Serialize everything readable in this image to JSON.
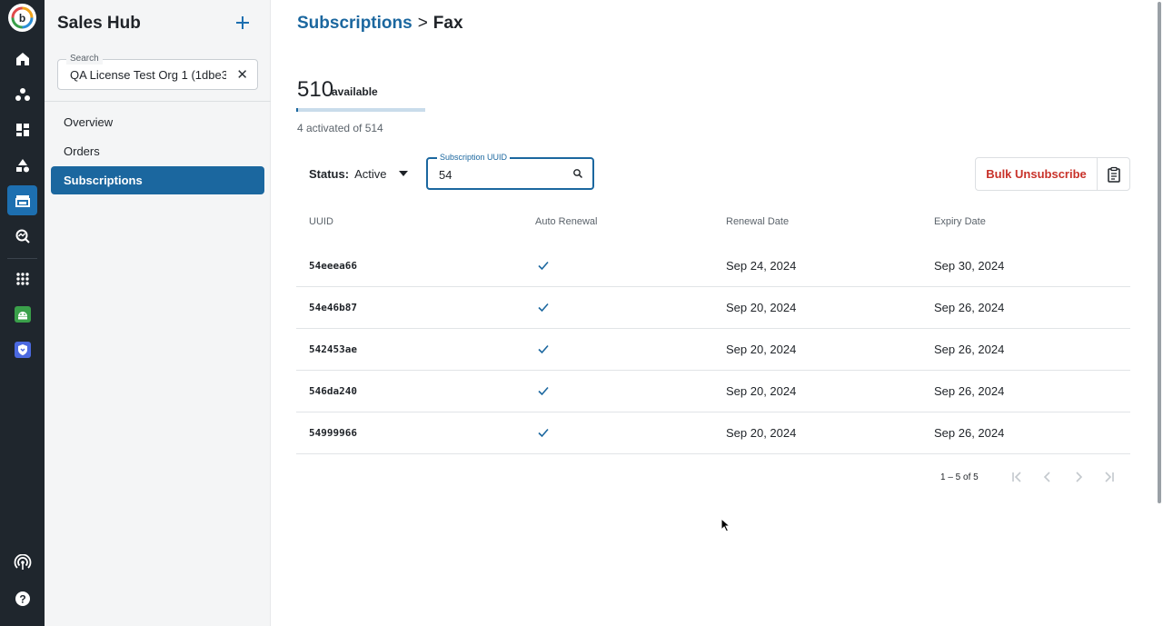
{
  "rail": {
    "icons": [
      "home-icon",
      "cluster-icon",
      "dashboard-icon",
      "shapes-icon",
      "store-icon",
      "analytics-search-icon",
      "apps-grid-icon",
      "android-icon",
      "shield-icon",
      "broadcast-icon",
      "help-icon"
    ],
    "active": "store-icon",
    "colors": {
      "bg": "#1f262d",
      "active": "#1d6fb0",
      "android": "#3aa04a",
      "shield": "#4b69e0"
    }
  },
  "sidebar": {
    "title": "Sales Hub",
    "search": {
      "label": "Search",
      "value": "QA License Test Org 1 (1dbe3"
    },
    "items": [
      {
        "label": "Overview",
        "active": false
      },
      {
        "label": "Orders",
        "active": false
      },
      {
        "label": "Subscriptions",
        "active": true
      }
    ]
  },
  "breadcrumb": {
    "parent": "Subscriptions",
    "separator": ">",
    "current": "Fax"
  },
  "summary": {
    "available_count": "510",
    "available_label": "available",
    "activated_text": "4 activated of 514",
    "usage_fraction": 0.0078
  },
  "filters": {
    "status_label": "Status:",
    "status_value": "Active",
    "uuid_label": "Subscription UUID",
    "uuid_value": "54"
  },
  "actions": {
    "bulk_unsubscribe": "Bulk Unsubscribe"
  },
  "table": {
    "columns": [
      "UUID",
      "Auto Renewal",
      "Renewal Date",
      "Expiry Date"
    ],
    "rows": [
      {
        "uuid": "54eeea66",
        "auto_renewal": true,
        "renewal": "Sep 24, 2024",
        "expiry": "Sep 30, 2024"
      },
      {
        "uuid": "54e46b87",
        "auto_renewal": true,
        "renewal": "Sep 20, 2024",
        "expiry": "Sep 26, 2024"
      },
      {
        "uuid": "542453ae",
        "auto_renewal": true,
        "renewal": "Sep 20, 2024",
        "expiry": "Sep 26, 2024"
      },
      {
        "uuid": "546da240",
        "auto_renewal": true,
        "renewal": "Sep 20, 2024",
        "expiry": "Sep 26, 2024"
      },
      {
        "uuid": "54999966",
        "auto_renewal": true,
        "renewal": "Sep 20, 2024",
        "expiry": "Sep 26, 2024"
      }
    ]
  },
  "pagination": {
    "range_text": "1 – 5 of 5"
  },
  "colors": {
    "primary": "#1b679f",
    "danger": "#c8322a",
    "check": "#1b679f"
  }
}
